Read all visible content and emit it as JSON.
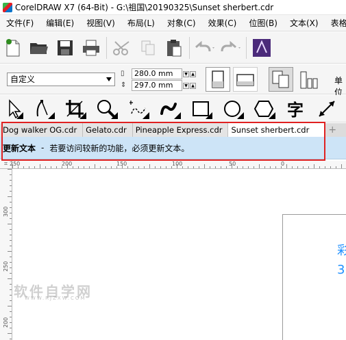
{
  "window": {
    "title": "CorelDRAW X7 (64-Bit) - G:\\祖国\\20190325\\Sunset sherbert.cdr"
  },
  "menu": [
    "文件(F)",
    "编辑(E)",
    "视图(V)",
    "布局(L)",
    "对象(C)",
    "效果(C)",
    "位图(B)",
    "文本(X)",
    "表格(T)"
  ],
  "toolbar": {
    "icons": [
      "new-icon",
      "open-icon",
      "save-icon",
      "print-icon",
      "cut-icon",
      "copy-icon",
      "paste-icon",
      "undo-icon",
      "redo-icon",
      "launch-icon"
    ]
  },
  "propbar": {
    "preset": "自定义",
    "width": "280.0 mm",
    "height": "297.0 mm",
    "unit_label": "单位"
  },
  "tools": [
    "pick-tool-icon",
    "shape-tool-icon",
    "crop-tool-icon",
    "zoom-tool-icon",
    "freehand-tool-icon",
    "artistic-media-icon",
    "rectangle-tool-icon",
    "ellipse-tool-icon",
    "polygon-tool-icon",
    "text-tool-icon",
    "dimension-tool-icon"
  ],
  "tools_text": {
    "text_tool": "字"
  },
  "tabs": [
    {
      "label": "Dog walker OG.cdr",
      "active": false
    },
    {
      "label": "Gelato.cdr",
      "active": false
    },
    {
      "label": "Pineapple Express.cdr",
      "active": false
    },
    {
      "label": "Sunset sherbert.cdr",
      "active": true
    }
  ],
  "update_bar": {
    "title": "更新文本",
    "separator": "-",
    "message": "若要访问较新的功能，必须更新文本。"
  },
  "ruler": {
    "h_labels": [
      "250",
      "200",
      "150",
      "100",
      "50",
      "0"
    ],
    "v_labels": [
      "300",
      "250",
      "200"
    ]
  },
  "canvas": {
    "page_text_1": "彩",
    "page_text_2": "3"
  },
  "watermark": {
    "main": "软件自学网",
    "sub": "WWW.RJZXW.COM"
  },
  "colors": {
    "accent": "#1e90ff",
    "update_bar_bg": "#cde4f7",
    "highlight": "#e02020"
  }
}
